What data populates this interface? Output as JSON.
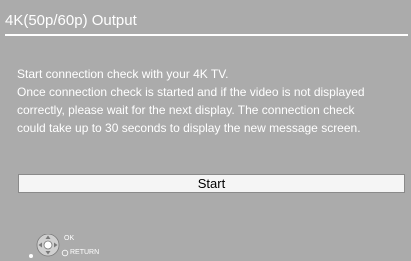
{
  "dialog": {
    "title": "4K(50p/60p) Output",
    "message_lines": [
      "Start connection check with your 4K TV.",
      "Once connection check is started and if the video is not displayed",
      "correctly, please wait for the next display. The connection check",
      "could take up to 30 seconds to display the new message screen."
    ],
    "start_button_label": "Start"
  },
  "nav_hints": {
    "ok_label": "OK",
    "return_label": "RETURN"
  },
  "colors": {
    "background": "#ababab",
    "text": "#ffffff",
    "button_bg": "#f5f5f5"
  },
  "icons": [
    "directional-pad-icon",
    "return-circle-icon"
  ]
}
